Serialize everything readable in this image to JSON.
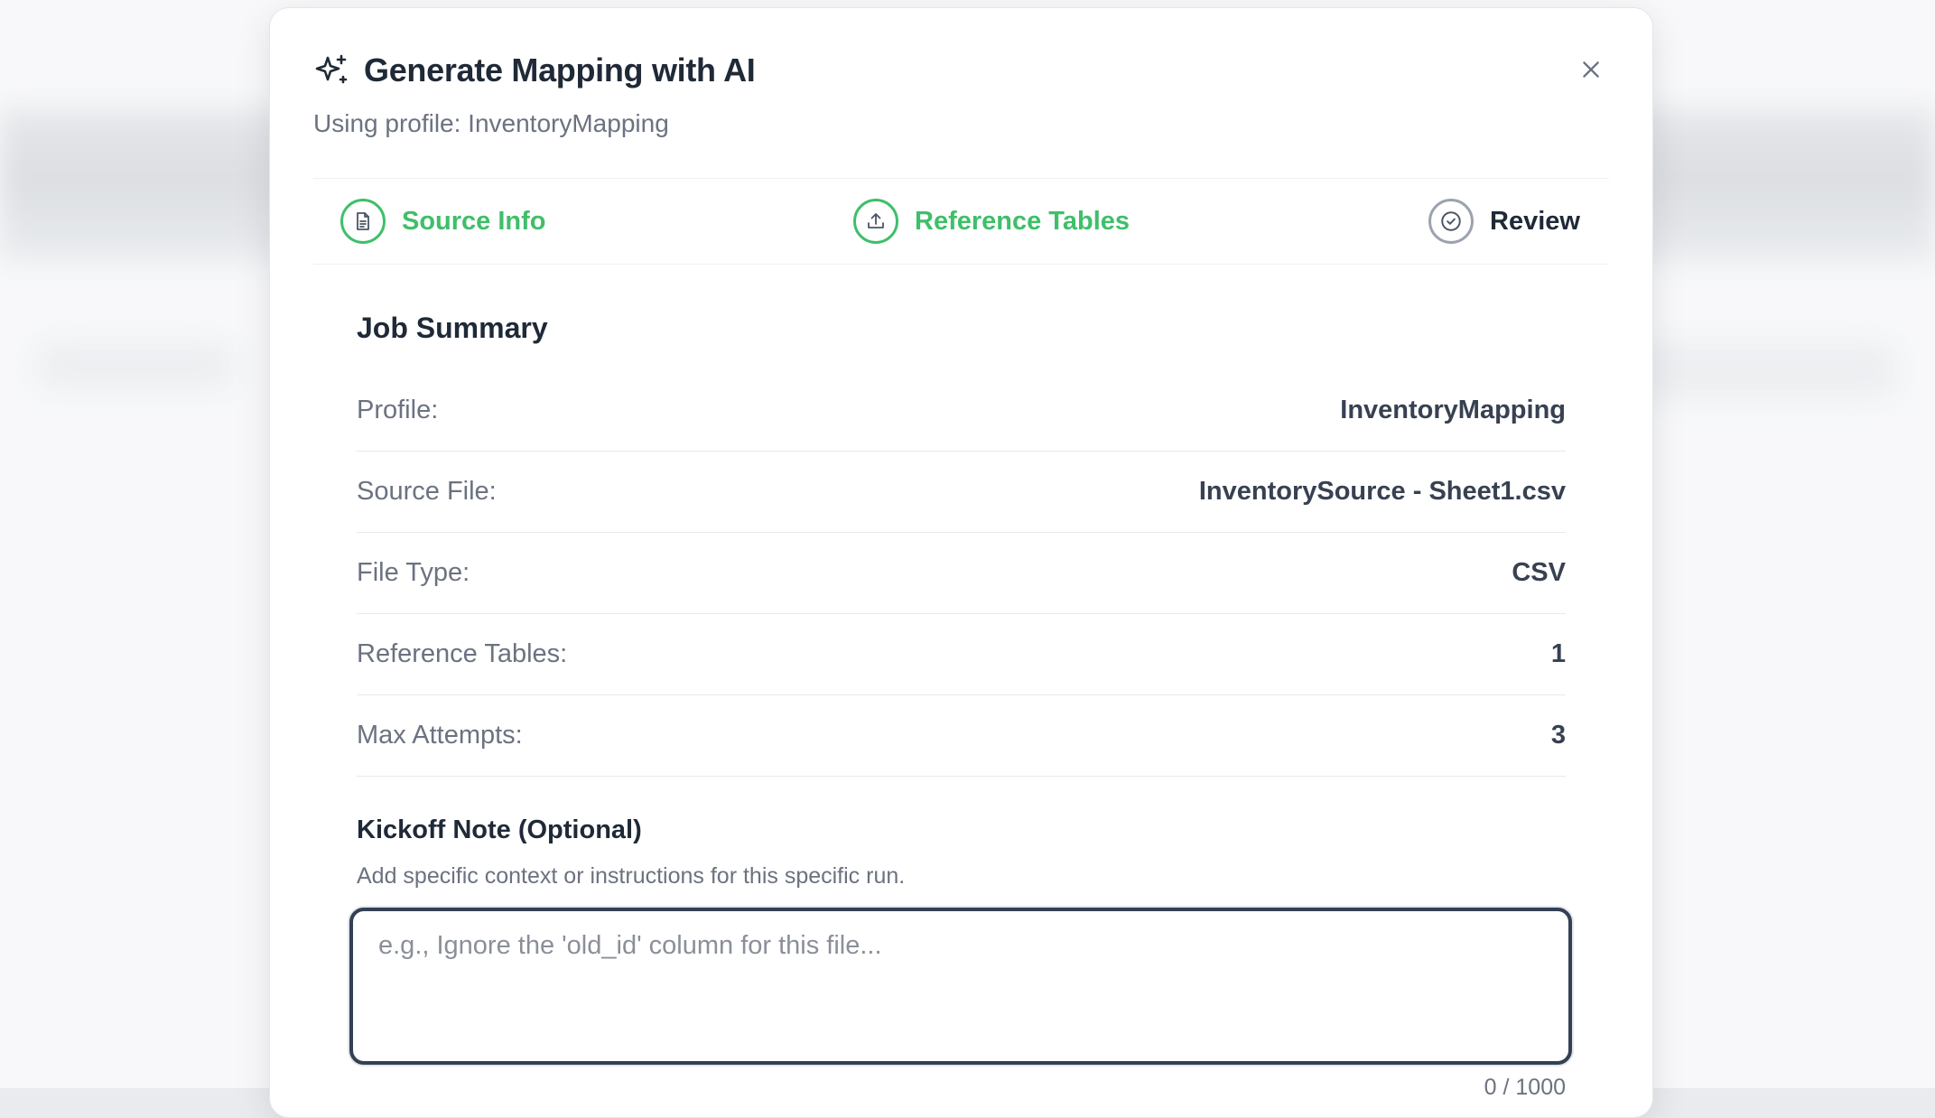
{
  "modal": {
    "title": "Generate Mapping with AI",
    "subtitle": "Using profile: InventoryMapping"
  },
  "steps": [
    {
      "label": "Source Info",
      "state": "done",
      "icon": "document-icon"
    },
    {
      "label": "Reference Tables",
      "state": "done",
      "icon": "upload-icon"
    },
    {
      "label": "Review",
      "state": "current",
      "icon": "check-circle-icon"
    }
  ],
  "summary": {
    "title": "Job Summary",
    "rows": [
      {
        "key": "Profile:",
        "value": "InventoryMapping"
      },
      {
        "key": "Source File:",
        "value": "InventorySource - Sheet1.csv"
      },
      {
        "key": "File Type:",
        "value": "CSV"
      },
      {
        "key": "Reference Tables:",
        "value": "1"
      },
      {
        "key": "Max Attempts:",
        "value": "3"
      }
    ]
  },
  "kickoff": {
    "title": "Kickoff Note (Optional)",
    "help": "Add specific context or instructions for this specific run.",
    "placeholder": "e.g., Ignore the 'old_id' column for this file...",
    "value": "",
    "char_count": "0 / 1000"
  },
  "colors": {
    "accent_green": "#3fbf6a",
    "text_dark": "#1f2937",
    "text_muted": "#6b7280",
    "focus_border": "#334155"
  }
}
